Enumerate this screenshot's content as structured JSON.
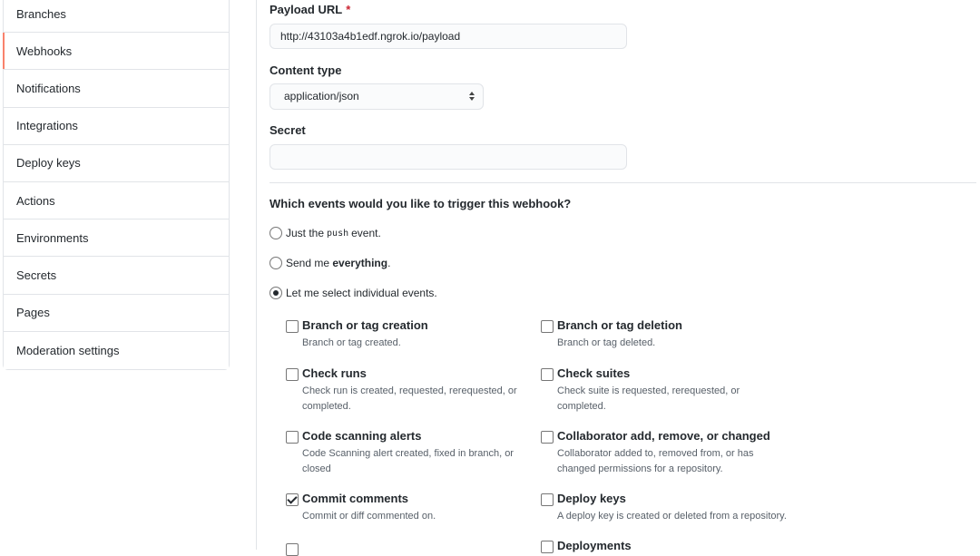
{
  "sidebar": {
    "items": [
      {
        "label": "Branches"
      },
      {
        "label": "Webhooks"
      },
      {
        "label": "Notifications"
      },
      {
        "label": "Integrations"
      },
      {
        "label": "Deploy keys"
      },
      {
        "label": "Actions"
      },
      {
        "label": "Environments"
      },
      {
        "label": "Secrets"
      },
      {
        "label": "Pages"
      },
      {
        "label": "Moderation settings"
      }
    ],
    "active": "Webhooks"
  },
  "form": {
    "payload_url_label": "Payload URL",
    "required_marker": "*",
    "payload_url_value": "http://43103a4b1edf.ngrok.io/payload",
    "content_type_label": "Content type",
    "content_type_value": "application/json",
    "secret_label": "Secret",
    "secret_value": ""
  },
  "events_question": "Which events would you like to trigger this webhook?",
  "trigger_options": {
    "just_push_prefix": "Just the",
    "just_push_code": "push",
    "just_push_suffix": "event.",
    "everything_prefix": "Send me",
    "everything_bold": "everything",
    "everything_suffix": ".",
    "individual": "Let me select individual events.",
    "selected": "individual"
  },
  "events": [
    {
      "title": "Branch or tag creation",
      "desc": "Branch or tag created.",
      "checked": false
    },
    {
      "title": "Branch or tag deletion",
      "desc": "Branch or tag deleted.",
      "checked": false
    },
    {
      "title": "Check runs",
      "desc": "Check run is created, requested, rerequested, or completed.",
      "checked": false
    },
    {
      "title": "Check suites",
      "desc": "Check suite is requested, rerequested, or completed.",
      "checked": false
    },
    {
      "title": "Code scanning alerts",
      "desc": "Code Scanning alert created, fixed in branch, or closed",
      "checked": false
    },
    {
      "title": "Collaborator add, remove, or changed",
      "desc": "Collaborator added to, removed from, or has changed permissions for a repository.",
      "checked": false
    },
    {
      "title": "Commit comments",
      "desc": "Commit or diff commented on.",
      "checked": true
    },
    {
      "title": "Deploy keys",
      "desc": "A deploy key is created or deleted from a repository.",
      "checked": false
    },
    {
      "title": "",
      "desc": "",
      "checked": false
    },
    {
      "title": "Deployments",
      "desc": "",
      "checked": false
    }
  ]
}
